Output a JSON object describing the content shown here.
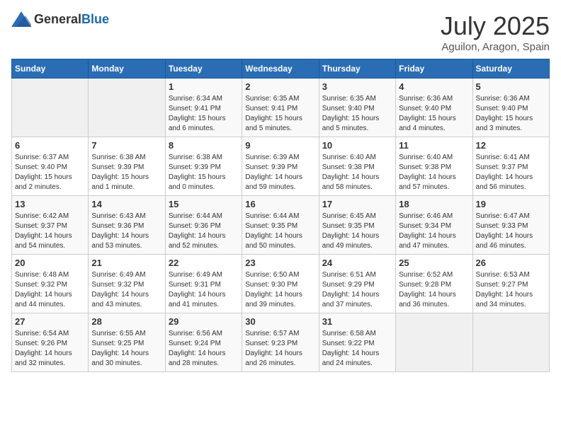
{
  "header": {
    "logo_general": "General",
    "logo_blue": "Blue",
    "month": "July 2025",
    "location": "Aguilon, Aragon, Spain"
  },
  "weekdays": [
    "Sunday",
    "Monday",
    "Tuesday",
    "Wednesday",
    "Thursday",
    "Friday",
    "Saturday"
  ],
  "weeks": [
    [
      {
        "day": "",
        "empty": true
      },
      {
        "day": "",
        "empty": true
      },
      {
        "day": "1",
        "sunrise": "Sunrise: 6:34 AM",
        "sunset": "Sunset: 9:41 PM",
        "daylight": "Daylight: 15 hours and 6 minutes."
      },
      {
        "day": "2",
        "sunrise": "Sunrise: 6:35 AM",
        "sunset": "Sunset: 9:41 PM",
        "daylight": "Daylight: 15 hours and 5 minutes."
      },
      {
        "day": "3",
        "sunrise": "Sunrise: 6:35 AM",
        "sunset": "Sunset: 9:40 PM",
        "daylight": "Daylight: 15 hours and 5 minutes."
      },
      {
        "day": "4",
        "sunrise": "Sunrise: 6:36 AM",
        "sunset": "Sunset: 9:40 PM",
        "daylight": "Daylight: 15 hours and 4 minutes."
      },
      {
        "day": "5",
        "sunrise": "Sunrise: 6:36 AM",
        "sunset": "Sunset: 9:40 PM",
        "daylight": "Daylight: 15 hours and 3 minutes."
      }
    ],
    [
      {
        "day": "6",
        "sunrise": "Sunrise: 6:37 AM",
        "sunset": "Sunset: 9:40 PM",
        "daylight": "Daylight: 15 hours and 2 minutes."
      },
      {
        "day": "7",
        "sunrise": "Sunrise: 6:38 AM",
        "sunset": "Sunset: 9:39 PM",
        "daylight": "Daylight: 15 hours and 1 minute."
      },
      {
        "day": "8",
        "sunrise": "Sunrise: 6:38 AM",
        "sunset": "Sunset: 9:39 PM",
        "daylight": "Daylight: 15 hours and 0 minutes."
      },
      {
        "day": "9",
        "sunrise": "Sunrise: 6:39 AM",
        "sunset": "Sunset: 9:39 PM",
        "daylight": "Daylight: 14 hours and 59 minutes."
      },
      {
        "day": "10",
        "sunrise": "Sunrise: 6:40 AM",
        "sunset": "Sunset: 9:38 PM",
        "daylight": "Daylight: 14 hours and 58 minutes."
      },
      {
        "day": "11",
        "sunrise": "Sunrise: 6:40 AM",
        "sunset": "Sunset: 9:38 PM",
        "daylight": "Daylight: 14 hours and 57 minutes."
      },
      {
        "day": "12",
        "sunrise": "Sunrise: 6:41 AM",
        "sunset": "Sunset: 9:37 PM",
        "daylight": "Daylight: 14 hours and 56 minutes."
      }
    ],
    [
      {
        "day": "13",
        "sunrise": "Sunrise: 6:42 AM",
        "sunset": "Sunset: 9:37 PM",
        "daylight": "Daylight: 14 hours and 54 minutes."
      },
      {
        "day": "14",
        "sunrise": "Sunrise: 6:43 AM",
        "sunset": "Sunset: 9:36 PM",
        "daylight": "Daylight: 14 hours and 53 minutes."
      },
      {
        "day": "15",
        "sunrise": "Sunrise: 6:44 AM",
        "sunset": "Sunset: 9:36 PM",
        "daylight": "Daylight: 14 hours and 52 minutes."
      },
      {
        "day": "16",
        "sunrise": "Sunrise: 6:44 AM",
        "sunset": "Sunset: 9:35 PM",
        "daylight": "Daylight: 14 hours and 50 minutes."
      },
      {
        "day": "17",
        "sunrise": "Sunrise: 6:45 AM",
        "sunset": "Sunset: 9:35 PM",
        "daylight": "Daylight: 14 hours and 49 minutes."
      },
      {
        "day": "18",
        "sunrise": "Sunrise: 6:46 AM",
        "sunset": "Sunset: 9:34 PM",
        "daylight": "Daylight: 14 hours and 47 minutes."
      },
      {
        "day": "19",
        "sunrise": "Sunrise: 6:47 AM",
        "sunset": "Sunset: 9:33 PM",
        "daylight": "Daylight: 14 hours and 46 minutes."
      }
    ],
    [
      {
        "day": "20",
        "sunrise": "Sunrise: 6:48 AM",
        "sunset": "Sunset: 9:32 PM",
        "daylight": "Daylight: 14 hours and 44 minutes."
      },
      {
        "day": "21",
        "sunrise": "Sunrise: 6:49 AM",
        "sunset": "Sunset: 9:32 PM",
        "daylight": "Daylight: 14 hours and 43 minutes."
      },
      {
        "day": "22",
        "sunrise": "Sunrise: 6:49 AM",
        "sunset": "Sunset: 9:31 PM",
        "daylight": "Daylight: 14 hours and 41 minutes."
      },
      {
        "day": "23",
        "sunrise": "Sunrise: 6:50 AM",
        "sunset": "Sunset: 9:30 PM",
        "daylight": "Daylight: 14 hours and 39 minutes."
      },
      {
        "day": "24",
        "sunrise": "Sunrise: 6:51 AM",
        "sunset": "Sunset: 9:29 PM",
        "daylight": "Daylight: 14 hours and 37 minutes."
      },
      {
        "day": "25",
        "sunrise": "Sunrise: 6:52 AM",
        "sunset": "Sunset: 9:28 PM",
        "daylight": "Daylight: 14 hours and 36 minutes."
      },
      {
        "day": "26",
        "sunrise": "Sunrise: 6:53 AM",
        "sunset": "Sunset: 9:27 PM",
        "daylight": "Daylight: 14 hours and 34 minutes."
      }
    ],
    [
      {
        "day": "27",
        "sunrise": "Sunrise: 6:54 AM",
        "sunset": "Sunset: 9:26 PM",
        "daylight": "Daylight: 14 hours and 32 minutes."
      },
      {
        "day": "28",
        "sunrise": "Sunrise: 6:55 AM",
        "sunset": "Sunset: 9:25 PM",
        "daylight": "Daylight: 14 hours and 30 minutes."
      },
      {
        "day": "29",
        "sunrise": "Sunrise: 6:56 AM",
        "sunset": "Sunset: 9:24 PM",
        "daylight": "Daylight: 14 hours and 28 minutes."
      },
      {
        "day": "30",
        "sunrise": "Sunrise: 6:57 AM",
        "sunset": "Sunset: 9:23 PM",
        "daylight": "Daylight: 14 hours and 26 minutes."
      },
      {
        "day": "31",
        "sunrise": "Sunrise: 6:58 AM",
        "sunset": "Sunset: 9:22 PM",
        "daylight": "Daylight: 14 hours and 24 minutes."
      },
      {
        "day": "",
        "empty": true
      },
      {
        "day": "",
        "empty": true
      }
    ]
  ]
}
